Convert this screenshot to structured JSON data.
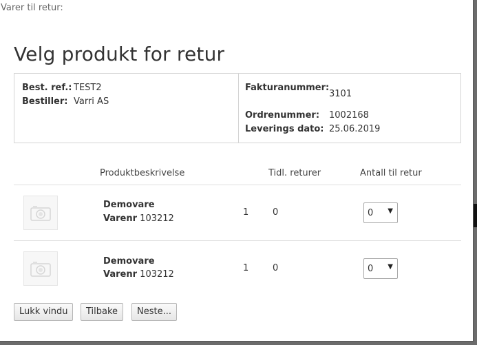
{
  "window": {
    "title": "Varer til retur:"
  },
  "heading": "Velg produkt for retur",
  "order_info": {
    "best_ref_label": "Best. ref.:",
    "best_ref_value": "TEST2",
    "bestiller_label": "Bestiller:",
    "bestiller_value": "Varri AS",
    "fakturanummer_label": "Fakturanummer:",
    "fakturanummer_value": "3101",
    "ordrenummer_label": "Ordrenummer:",
    "ordrenummer_value": "1002168",
    "leverings_dato_label": "Leverings dato:",
    "leverings_dato_value": "25.06.2019"
  },
  "table": {
    "columns": [
      "Produktbeskrivelse",
      "Tidl. returer",
      "Antall til retur"
    ],
    "rows": [
      {
        "name": "Demovare",
        "varenr_label": "Varenr",
        "varenr": "103212",
        "quantity": "1",
        "previous_returns": "0",
        "return_amount": "0",
        "image_icon": "camera-placeholder-icon"
      },
      {
        "name": "Demovare",
        "varenr_label": "Varenr",
        "varenr": "103212",
        "quantity": "1",
        "previous_returns": "0",
        "return_amount": "0",
        "image_icon": "camera-placeholder-icon"
      }
    ]
  },
  "buttons": {
    "close": "Lukk vindu",
    "back": "Tilbake",
    "next": "Neste..."
  },
  "icons": {
    "dropdown": "chevron-down-icon"
  }
}
